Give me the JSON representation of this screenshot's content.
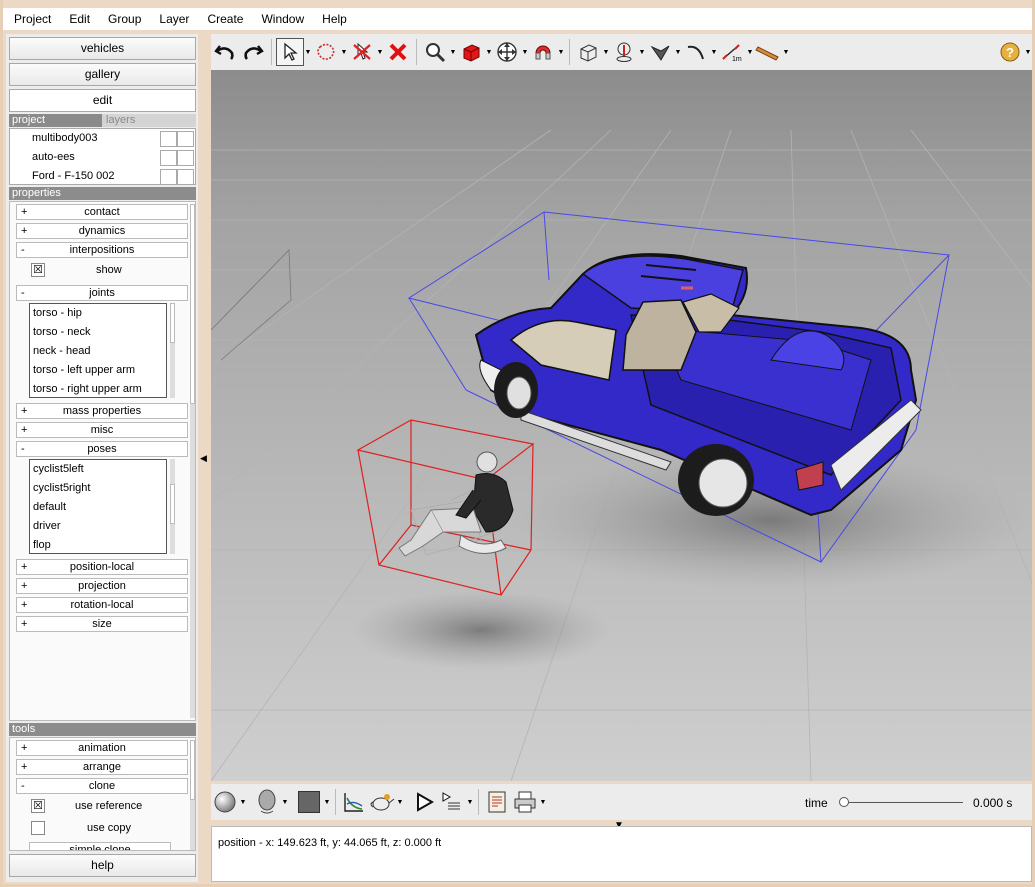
{
  "menu": [
    "Project",
    "Edit",
    "Group",
    "Layer",
    "Create",
    "Window",
    "Help"
  ],
  "left": {
    "buttons": {
      "vehicles": "vehicles",
      "gallery": "gallery",
      "edit": "edit",
      "help": "help"
    },
    "tabs": {
      "project": "project",
      "layers": "layers"
    },
    "project_items": [
      "multibody003",
      "auto-ees",
      "Ford - F-150 002"
    ],
    "properties": {
      "header": "properties",
      "contact": {
        "sign": "+",
        "label": "contact"
      },
      "dynamics": {
        "sign": "+",
        "label": "dynamics"
      },
      "interpositions": {
        "sign": "-",
        "label": "interpositions"
      },
      "show": {
        "label": "show",
        "checked": "☒"
      },
      "joints": {
        "sign": "-",
        "label": "joints"
      },
      "joint_items": [
        "torso - hip",
        "torso - neck",
        "neck - head",
        "torso - left upper arm",
        "torso - right upper arm"
      ],
      "mass": {
        "sign": "+",
        "label": "mass properties"
      },
      "misc": {
        "sign": "+",
        "label": "misc"
      },
      "poses": {
        "sign": "-",
        "label": "poses"
      },
      "pose_items": [
        "cyclist5left",
        "cyclist5right",
        "default",
        "driver",
        "flop"
      ],
      "position_local": {
        "sign": "+",
        "label": "position-local"
      },
      "projection": {
        "sign": "+",
        "label": "projection"
      },
      "rotation_local": {
        "sign": "+",
        "label": "rotation-local"
      },
      "size": {
        "sign": "+",
        "label": "size"
      }
    },
    "tools": {
      "header": "tools",
      "animation": {
        "sign": "+",
        "label": "animation"
      },
      "arrange": {
        "sign": "+",
        "label": "arrange"
      },
      "clone": {
        "sign": "-",
        "label": "clone"
      },
      "use_reference": {
        "label": "use reference",
        "checked": "☒"
      },
      "use_copy": {
        "label": "use copy",
        "checked": ""
      },
      "simple_clone": "simple clone"
    }
  },
  "timeline": {
    "label": "time",
    "value": "0.000 s",
    "position": 0
  },
  "status": {
    "text": "position - x: 149.623 ft, y: 44.065 ft, z: 0.000 ft"
  },
  "icons": [
    "undo-icon",
    "redo-icon",
    "select-arrow-icon",
    "lasso-icon",
    "no-select-icon",
    "delete-icon",
    "zoom-icon",
    "red-cube-icon",
    "move-icon",
    "magnet-icon",
    "box-icon",
    "pin-icon",
    "plane-icon",
    "curve-icon",
    "measure-icon",
    "ruler-icon",
    "help-icon"
  ],
  "colors": {
    "truck": "#3a2fd0",
    "selection": "#e02020",
    "bbox": "#4040e0"
  }
}
